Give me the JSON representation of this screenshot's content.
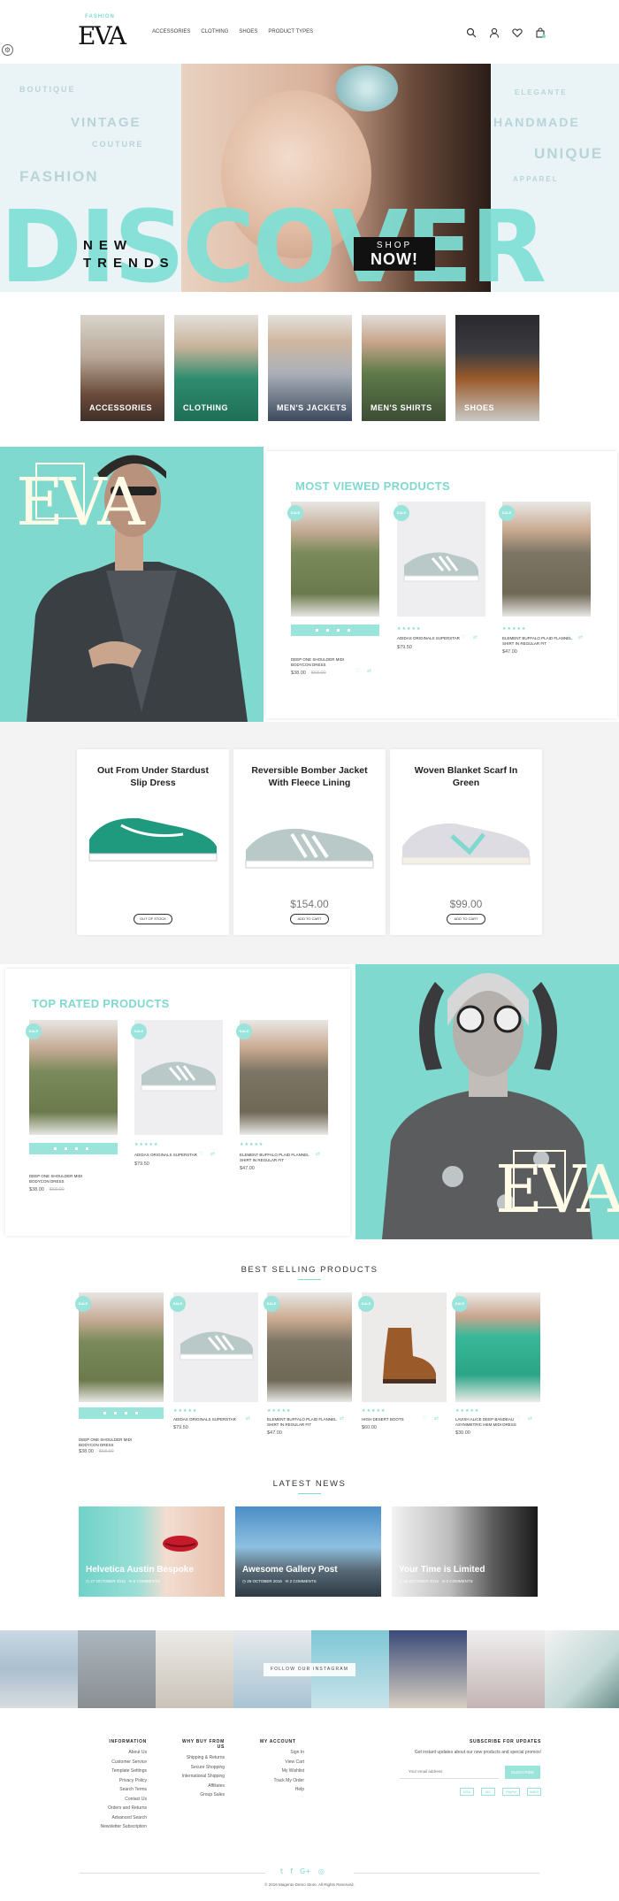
{
  "brand": {
    "logo_top": "FASHION",
    "logo": "EVA"
  },
  "nav": [
    "ACCESSORIES",
    "CLOTHING",
    "SHOES",
    "PRODUCT TYPES"
  ],
  "hero": {
    "discover": "DISCOVER",
    "line1": "NEW",
    "line2": "TRENDS",
    "shop1": "SHOP",
    "shop2": "NOW!",
    "ghost": [
      "BOUTIQUE",
      "VINTAGE",
      "COUTURE",
      "FASHION",
      "ELEGANTE",
      "HANDMADE",
      "UNIQUE",
      "APPAREL"
    ]
  },
  "categories": [
    "ACCESSORIES",
    "CLOTHING",
    "MEN'S JACKETS",
    "MEN'S SHIRTS",
    "SHOES"
  ],
  "promo_logo": "EVA",
  "most_viewed": {
    "title": "MOST VIEWED PRODUCTS",
    "items": [
      {
        "sale": "SALE",
        "name": "DEEP ONE SHOULDER MIDI BODYCON DRESS",
        "price": "$38.00",
        "old": "$68.00"
      },
      {
        "sale": "SALE",
        "name": "ADIDAS ORIGINALS SUPERSTAR",
        "price": "$79.50",
        "old": ""
      },
      {
        "sale": "SALE",
        "name": "ELEMENT BUFFALO PLAID FLANNEL SHIRT IN REGULAR FIT",
        "price": "$47.00",
        "old": ""
      }
    ]
  },
  "featured": [
    {
      "title": "Out From Under Stardust Slip Dress",
      "price": "",
      "button": "OUT OF STOCK"
    },
    {
      "title": "Reversible Bomber Jacket With Fleece Lining",
      "price": "$154.00",
      "button": "ADD TO CART"
    },
    {
      "title": "Woven Blanket Scarf In Green",
      "price": "$99.00",
      "button": "ADD TO CART"
    }
  ],
  "top_rated": {
    "title": "TOP RATED PRODUCTS",
    "items": [
      {
        "sale": "SALE",
        "name": "DEEP ONE SHOULDER MIDI BODYCON DRESS",
        "price": "$38.00",
        "old": "$68.00"
      },
      {
        "sale": "SALE",
        "name": "ADIDAS ORIGINALS SUPERSTAR",
        "price": "$79.50",
        "old": ""
      },
      {
        "sale": "SALE",
        "name": "ELEMENT BUFFALO PLAID FLANNEL SHIRT IN REGULAR FIT",
        "price": "$47.00",
        "old": ""
      }
    ]
  },
  "best_selling": {
    "title": "BEST SELLING PRODUCTS",
    "items": [
      {
        "sale": "SALE",
        "name": "DEEP ONE SHOULDER MIDI BODYCON DRESS",
        "price": "$38.00",
        "old": "$68.00"
      },
      {
        "sale": "SALE",
        "name": "ADIDAS ORIGINALS SUPERSTAR",
        "price": "$79.50",
        "old": ""
      },
      {
        "sale": "SALE",
        "name": "ELEMENT BUFFALO PLAID FLANNEL SHIRT IN REGULAR FIT",
        "price": "$47.00",
        "old": ""
      },
      {
        "sale": "SALE",
        "name": "HIGH DESERT BOOTS",
        "price": "$60.00",
        "old": ""
      },
      {
        "sale": "SALE",
        "name": "LAVISH ALICE DEEP BANDEAU ASYMMETRIC HEM MIDI DRESS",
        "price": "$30.00",
        "old": ""
      }
    ]
  },
  "latest_news": {
    "title": "LATEST NEWS",
    "items": [
      {
        "title": "Helvetica Austin Bespoke",
        "date": "27 OCTOBER 2016",
        "comments": "8 COMMENTS"
      },
      {
        "title": "Awesome Gallery Post",
        "date": "26 OCTOBER 2016",
        "comments": "2 COMMENTS"
      },
      {
        "title": "Your Time is Limited",
        "date": "26 OCTOBER 2016",
        "comments": "5 COMMENTS"
      }
    ]
  },
  "instagram": "FOLLOW OUR INSTAGRAM",
  "footer": {
    "information": {
      "title": "INFORMATION",
      "links": [
        "About Us",
        "Customer Service",
        "Template Settings",
        "Privacy Policy",
        "Search Terms",
        "Contact Us",
        "Orders and Returns",
        "Advanced Search",
        "Newsletter Subscription"
      ]
    },
    "why": {
      "title": "WHY BUY FROM US",
      "links": [
        "Shipping & Returns",
        "Secure Shopping",
        "International Shipping",
        "Affiliates",
        "Group Sales"
      ]
    },
    "account": {
      "title": "MY ACCOUNT",
      "links": [
        "Sign In",
        "View Cart",
        "My Wishlist",
        "Track My Order",
        "Help"
      ]
    },
    "subscribe": {
      "title": "SUBSCRIBE FOR UPDATES",
      "text": "Get instant updates about our new products and special promos!",
      "placeholder": "Your email address",
      "button": "SUBSCRIBE",
      "payments": [
        "VISA",
        "MC",
        "PayPal",
        "AMEX"
      ]
    },
    "copyright": "© 2016 Magento Demo Store. All Rights Reserved."
  },
  "colors": {
    "accent": "#7fd9cf",
    "accent_light": "#9ae4dc",
    "dark": "#111111"
  }
}
